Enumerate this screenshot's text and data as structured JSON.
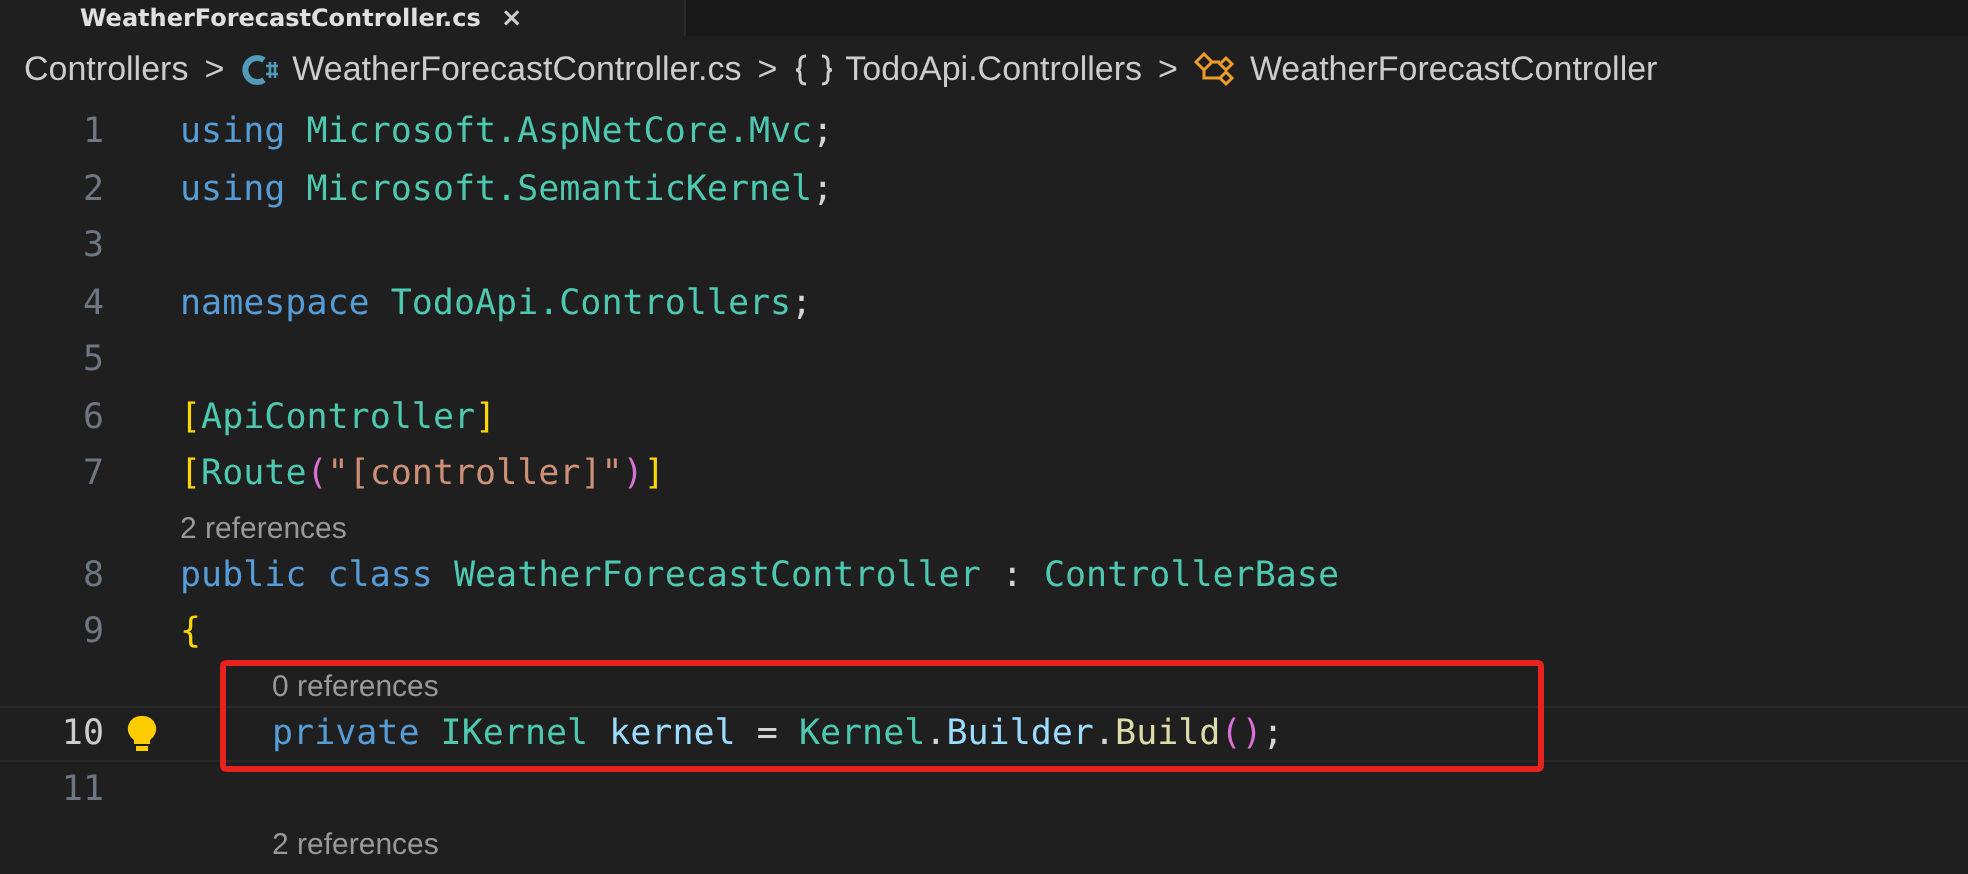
{
  "tab": {
    "label": "WeatherForecastController.cs",
    "close": "×"
  },
  "breadcrumbs": [
    {
      "label": "Controllers",
      "kind": "folder"
    },
    {
      "label": "WeatherForecastController.cs",
      "kind": "file"
    },
    {
      "label": "TodoApi.Controllers",
      "kind": "namespace"
    },
    {
      "label": "WeatherForecastController",
      "kind": "class"
    }
  ],
  "breadcrumb_separator": ">",
  "lines": [
    {
      "kind": "code",
      "number": "1",
      "current": false,
      "tokens": [
        {
          "t": "using",
          "color": "#569cd6"
        },
        {
          "t": " Microsoft.AspNetCore.Mvc",
          "color": "#4ec9b0"
        },
        {
          "t": ";",
          "color": "#d4d4d4"
        }
      ]
    },
    {
      "kind": "code",
      "number": "2",
      "current": false,
      "tokens": [
        {
          "t": "using",
          "color": "#569cd6"
        },
        {
          "t": " Microsoft.SemanticKernel",
          "color": "#4ec9b0"
        },
        {
          "t": ";",
          "color": "#d4d4d4"
        }
      ]
    },
    {
      "kind": "code",
      "number": "3",
      "current": false
    },
    {
      "kind": "code",
      "number": "4",
      "current": false,
      "tokens": [
        {
          "t": "namespace",
          "color": "#569cd6"
        },
        {
          "t": " TodoApi.Controllers",
          "color": "#4ec9b0"
        },
        {
          "t": ";",
          "color": "#d4d4d4"
        }
      ]
    },
    {
      "kind": "code",
      "number": "5",
      "current": false
    },
    {
      "kind": "code",
      "number": "6",
      "current": false,
      "tokens": [
        {
          "t": "[",
          "color": "#ffd700"
        },
        {
          "t": "ApiController",
          "color": "#4ec9b0"
        },
        {
          "t": "]",
          "color": "#ffd700"
        }
      ]
    },
    {
      "kind": "code",
      "number": "7",
      "current": false,
      "tokens": [
        {
          "t": "[",
          "color": "#ffd700"
        },
        {
          "t": "Route",
          "color": "#4ec9b0"
        },
        {
          "t": "(",
          "color": "#da70d6"
        },
        {
          "t": "\"[controller]\"",
          "color": "#ce9178"
        },
        {
          "t": ")",
          "color": "#da70d6"
        },
        {
          "t": "]",
          "color": "#ffd700"
        }
      ]
    },
    {
      "kind": "codelens",
      "text": "2 references"
    },
    {
      "kind": "code",
      "number": "8",
      "current": false,
      "tokens": [
        {
          "t": "public class",
          "color": "#569cd6"
        },
        {
          "t": " WeatherForecastController",
          "color": "#4ec9b0"
        },
        {
          "t": " :",
          "color": "#d4d4d4"
        },
        {
          "t": " ControllerBase",
          "color": "#4ec9b0"
        }
      ]
    },
    {
      "kind": "code",
      "number": "9",
      "current": false,
      "tokens": [
        {
          "t": "{",
          "color": "#ffd700"
        }
      ],
      "children": [
        {
          "kind": "codelens",
          "text": "0 references"
        },
        {
          "kind": "code",
          "number": "10",
          "current": true,
          "highlighted": true,
          "lightbulb": true,
          "tokens": [
            {
              "t": "private",
              "color": "#569cd6"
            },
            {
              "t": " IKernel",
              "color": "#4ec9b0"
            },
            {
              "t": " kernel",
              "color": "#9cdcfe"
            },
            {
              "t": " =",
              "color": "#d4d4d4"
            },
            {
              "t": " Kernel",
              "color": "#4ec9b0"
            },
            {
              "t": ".",
              "color": "#d4d4d4"
            },
            {
              "t": "Builder",
              "color": "#9cdcfe"
            },
            {
              "t": ".",
              "color": "#d4d4d4"
            },
            {
              "t": "Build",
              "color": "#dcdcaa"
            },
            {
              "t": "()",
              "color": "#da70d6"
            },
            {
              "t": ";",
              "color": "#d4d4d4"
            }
          ]
        },
        {
          "kind": "code",
          "number": "11",
          "current": false
        },
        {
          "kind": "codelens",
          "text": "2 references"
        }
      ]
    }
  ]
}
